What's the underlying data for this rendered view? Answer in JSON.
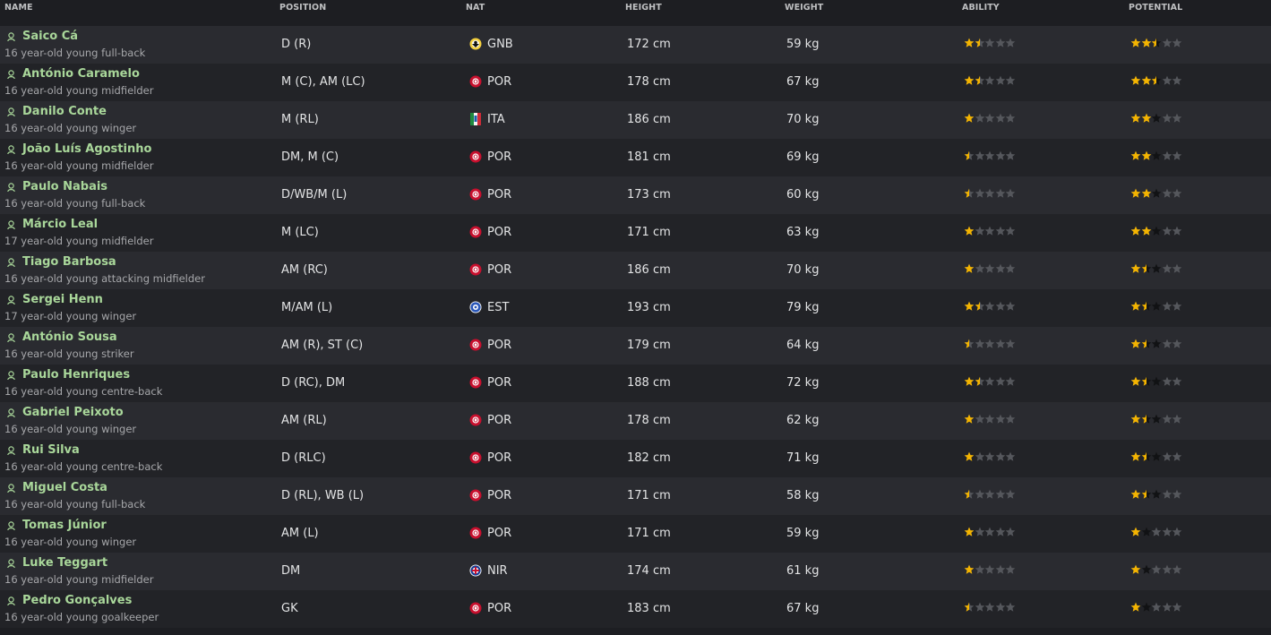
{
  "header": {
    "name": "NAME",
    "position": "POSITION",
    "nat": "NAT",
    "height": "HEIGHT",
    "weight": "WEIGHT",
    "ability": "ABILITY",
    "potential": "POTENTIAL"
  },
  "colors": {
    "name_green": "#a9d79a",
    "star_gold": "#f4b400",
    "star_grey": "#55575c",
    "star_dark": "#111214"
  },
  "players": [
    {
      "name": "Saico Cá",
      "desc": "16 year-old young full-back",
      "position": "D (R)",
      "nat": "GNB",
      "flag": "gnb-flag",
      "height": "172 cm",
      "weight": "59 kg",
      "ability": 1.5,
      "potential": 2.5,
      "potential_range": 3.0
    },
    {
      "name": "António Caramelo",
      "desc": "16 year-old young midfielder",
      "position": "M (C), AM (LC)",
      "nat": "POR",
      "flag": "por-flag",
      "height": "178 cm",
      "weight": "67 kg",
      "ability": 1.5,
      "potential": 2.5,
      "potential_range": 3.0
    },
    {
      "name": "Danilo Conte",
      "desc": "16 year-old young winger",
      "position": "M (RL)",
      "nat": "ITA",
      "flag": "ita-flag",
      "height": "186 cm",
      "weight": "70 kg",
      "ability": 1.0,
      "potential": 2.0,
      "potential_range": 3.0
    },
    {
      "name": "João Luís Agostinho",
      "desc": "16 year-old young midfielder",
      "position": "DM, M (C)",
      "nat": "POR",
      "flag": "por-flag",
      "height": "181 cm",
      "weight": "69 kg",
      "ability": 0.5,
      "potential": 2.0,
      "potential_range": 3.0
    },
    {
      "name": "Paulo Nabais",
      "desc": "16 year-old young full-back",
      "position": "D/WB/M (L)",
      "nat": "POR",
      "flag": "por-flag",
      "height": "173 cm",
      "weight": "60 kg",
      "ability": 0.5,
      "potential": 2.0,
      "potential_range": 3.0
    },
    {
      "name": "Márcio Leal",
      "desc": "17 year-old young midfielder",
      "position": "M (LC)",
      "nat": "POR",
      "flag": "por-flag",
      "height": "171 cm",
      "weight": "63 kg",
      "ability": 1.0,
      "potential": 2.0,
      "potential_range": 3.0
    },
    {
      "name": "Tiago Barbosa",
      "desc": "16 year-old young attacking midfielder",
      "position": "AM (RC)",
      "nat": "POR",
      "flag": "por-flag",
      "height": "186 cm",
      "weight": "70 kg",
      "ability": 1.0,
      "potential": 1.5,
      "potential_range": 2.5
    },
    {
      "name": "Sergei Henn",
      "desc": "17 year-old young winger",
      "position": "M/AM (L)",
      "nat": "EST",
      "flag": "est-flag",
      "height": "193 cm",
      "weight": "79 kg",
      "ability": 1.5,
      "potential": 1.5,
      "potential_range": 2.5
    },
    {
      "name": "António Sousa",
      "desc": "16 year-old young striker",
      "position": "AM (R), ST (C)",
      "nat": "POR",
      "flag": "por-flag",
      "height": "179 cm",
      "weight": "64 kg",
      "ability": 0.5,
      "potential": 1.5,
      "potential_range": 2.5
    },
    {
      "name": "Paulo Henriques",
      "desc": "16 year-old young centre-back",
      "position": "D (RC), DM",
      "nat": "POR",
      "flag": "por-flag",
      "height": "188 cm",
      "weight": "72 kg",
      "ability": 1.5,
      "potential": 1.5,
      "potential_range": 2.5
    },
    {
      "name": "Gabriel Peixoto",
      "desc": "16 year-old young winger",
      "position": "AM (RL)",
      "nat": "POR",
      "flag": "por-flag",
      "height": "178 cm",
      "weight": "62 kg",
      "ability": 1.0,
      "potential": 1.5,
      "potential_range": 2.5
    },
    {
      "name": "Rui Silva",
      "desc": "16 year-old young centre-back",
      "position": "D (RLC)",
      "nat": "POR",
      "flag": "por-flag",
      "height": "182 cm",
      "weight": "71 kg",
      "ability": 1.0,
      "potential": 1.5,
      "potential_range": 2.5
    },
    {
      "name": "Miguel Costa",
      "desc": "16 year-old young full-back",
      "position": "D (RL), WB (L)",
      "nat": "POR",
      "flag": "por-flag",
      "height": "171 cm",
      "weight": "58 kg",
      "ability": 0.5,
      "potential": 1.5,
      "potential_range": 2.5
    },
    {
      "name": "Tomas Júnior",
      "desc": "16 year-old young winger",
      "position": "AM (L)",
      "nat": "POR",
      "flag": "por-flag",
      "height": "171 cm",
      "weight": "59 kg",
      "ability": 1.0,
      "potential": 1.0,
      "potential_range": 2.0
    },
    {
      "name": "Luke Teggart",
      "desc": "16 year-old young midfielder",
      "position": "DM",
      "nat": "NIR",
      "flag": "nir-flag",
      "height": "174 cm",
      "weight": "61 kg",
      "ability": 1.0,
      "potential": 1.0,
      "potential_range": 2.0
    },
    {
      "name": "Pedro Gonçalves",
      "desc": "16 year-old young goalkeeper",
      "position": "GK",
      "nat": "POR",
      "flag": "por-flag",
      "height": "183 cm",
      "weight": "67 kg",
      "ability": 0.5,
      "potential": 1.0,
      "potential_range": 2.0
    }
  ]
}
